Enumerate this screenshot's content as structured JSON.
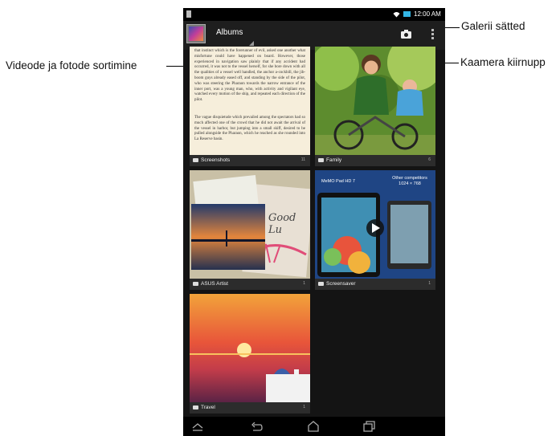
{
  "callouts": {
    "settings": "Galerii sätted",
    "sort": "Videode ja fotode sortimine",
    "camera": "Kaamera kiirnupp"
  },
  "status_bar": {
    "time": "12:00 AM"
  },
  "action_bar": {
    "title": "Albums",
    "icons": [
      "app-thumbnail-icon",
      "camera-icon",
      "overflow-menu-icon"
    ]
  },
  "albums": [
    {
      "name": "Screenshots",
      "count": "11"
    },
    {
      "name": "Family",
      "count": "6"
    },
    {
      "name": "ASUS Artist",
      "count": "1"
    },
    {
      "name": "Screensaver",
      "count": "1"
    },
    {
      "name": "Travel",
      "count": "1"
    }
  ],
  "screenshot_text": {
    "paragraph1": "that instinct which is the forerunner of evil, asked one another what misfortune could have happened on board. However, those experienced in navigation saw plainly that if any accident had occurred, it was not to the vessel herself, for she bore down with all the qualities of a vessel well handled, the anchor a-cockbill, the jib-boom guys already eased off, and standing by the side of the pilot, who was steering the Pharaon towards the narrow entrance of the inner port, was a young man, who, with activity and vigilant eye, watched every motion of the ship, and repeated each direction of the pilot.",
    "paragraph2": "The vague disquietude which prevailed among the spectators had so much affected one of the crowd that he did not await the arrival of the vessel in harbor, but jumping into a small skiff, desired to be pulled alongside the Pharaon, which he reached as she rounded into La Reserve basin."
  },
  "screensaver_text": {
    "title": "MeMO Pad HD 7",
    "subtitle": "Other competitors 1024 × 768"
  },
  "artist_text": "Good Lu",
  "colors": {
    "action_bar": "#1e1e1e",
    "grid_bg": "#141414",
    "caption_bar": "#2c2c2c",
    "page_bg": "#ffffff"
  }
}
